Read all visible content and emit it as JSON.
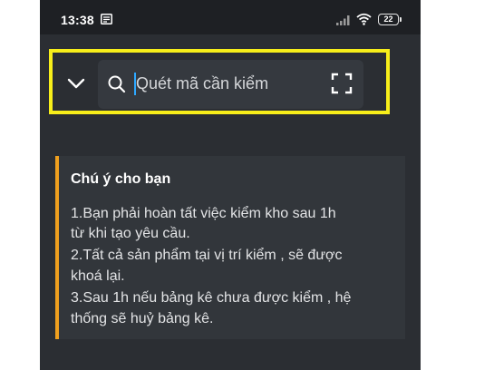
{
  "status_bar": {
    "time": "13:38",
    "battery": "22",
    "icons": [
      "notification-icon",
      "signal-icon",
      "wifi-icon",
      "battery-icon"
    ]
  },
  "search": {
    "placeholder": "Quét mã cần kiểm",
    "icons": [
      "chevron-down-icon",
      "search-icon",
      "scan-icon"
    ]
  },
  "notice": {
    "title": "Chú ý cho bạn",
    "lines": [
      "1.Bạn phải hoàn tất việc kiểm kho sau 1h",
      "từ khi tạo yêu cầu.",
      "2.Tất cả sản phẩm tại vị trí kiểm , sẽ được",
      "khoá lại.",
      "3.Sau 1h nếu bảng kê chưa được kiểm , hệ",
      "thống sẽ huỷ bảng kê."
    ]
  },
  "colors": {
    "background": "#2b2e33",
    "status_bar": "#1e2024",
    "search_box": "#35393f",
    "notice_card": "#32363b",
    "notice_accent": "#f0a01e",
    "highlight": "#f7ee1a",
    "caret": "#2ea8ff"
  }
}
